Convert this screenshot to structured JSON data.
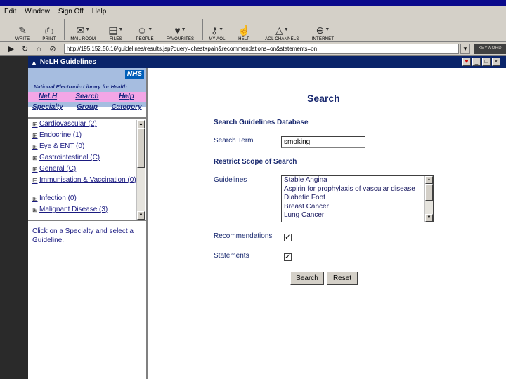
{
  "menu": [
    "Edit",
    "Window",
    "Sign Off",
    "Help"
  ],
  "toolbar": [
    {
      "label": "Write",
      "icon": "pencil-icon",
      "glyph": "✎"
    },
    {
      "label": "Print",
      "icon": "printer-icon",
      "glyph": "⎙"
    },
    {
      "label": "Mail Room",
      "icon": "mail-icon",
      "glyph": "✉"
    },
    {
      "label": "Files",
      "icon": "files-icon",
      "glyph": "▤"
    },
    {
      "label": "People",
      "icon": "people-icon",
      "glyph": "☺"
    },
    {
      "label": "Favourites",
      "icon": "heart-icon",
      "glyph": "♥"
    },
    {
      "label": "My AOL",
      "icon": "key-icon",
      "glyph": "⚷"
    },
    {
      "label": "Help",
      "icon": "help-hand-icon",
      "glyph": "☝"
    },
    {
      "label": "AOL Channels",
      "icon": "triangle-icon",
      "glyph": "△"
    },
    {
      "label": "Internet",
      "icon": "globe-icon",
      "glyph": "⊕"
    }
  ],
  "address": {
    "url": "http://195.152.56.16/guidelines/results.jsp?query=chest+pain&recommendations=on&statements=on",
    "keyword_label": "KEYWORD"
  },
  "window": {
    "title": "NeLH Guidelines"
  },
  "sidebar": {
    "nhs_logo": "NHS",
    "library_name": "National Electronic Library for Health",
    "links_row1": [
      "NeLH",
      "Search",
      "Help"
    ],
    "links_row2": [
      "Specialty",
      "Group",
      "Category"
    ],
    "specialties": [
      {
        "label": "Cardiovascular (2)",
        "expander": "⊞"
      },
      {
        "label": "Endocrine (1)",
        "expander": "⊞"
      },
      {
        "label": "Eye & ENT (0)",
        "expander": "⊞"
      },
      {
        "label": "Gastrointestinal (C)",
        "expander": "⊞"
      },
      {
        "label": "General (C)",
        "expander": "⊞"
      },
      {
        "label": "Immunisation & Vaccination (0)",
        "expander": "⊟"
      },
      {
        "label": "Infection (0)",
        "expander": "⊞"
      },
      {
        "label": "Malignant Disease (3)",
        "expander": "⊞"
      }
    ],
    "help_text": "Click on a Specialty and select a Guideline."
  },
  "main": {
    "title": "Search",
    "db_heading": "Search Guidelines Database",
    "search_term_label": "Search Term",
    "search_term_value": "smoking",
    "scope_heading": "Restrict Scope of Search",
    "guidelines_label": "Guidelines",
    "guidelines_options": [
      "Stable Angina",
      "Aspirin for prophylaxis of vascular disease",
      "Diabetic Foot",
      "Breast Cancer",
      "Lung Cancer"
    ],
    "recommendations_label": "Recommendations",
    "recommendations_checked": true,
    "statements_label": "Statements",
    "statements_checked": true,
    "search_button": "Search",
    "reset_button": "Reset"
  }
}
